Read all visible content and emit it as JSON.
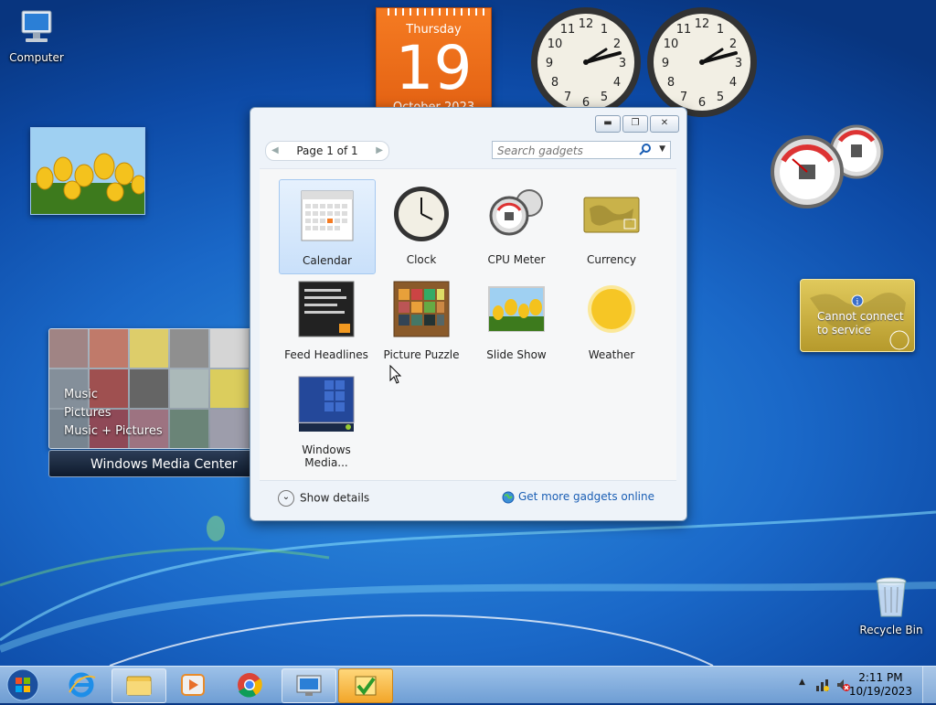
{
  "desktop": {
    "icons": [
      {
        "label": "Computer"
      },
      {
        "label": "Recycle Bin"
      }
    ]
  },
  "calendar_gadget": {
    "weekday": "Thursday",
    "day": "19",
    "month_year": "October 2023"
  },
  "media_center": {
    "menu": [
      "Music",
      "Pictures",
      "Music + Pictures"
    ],
    "title": "Windows Media Center"
  },
  "currency_gadget": {
    "message_line1": "Cannot connect",
    "message_line2": "to service"
  },
  "cpu_gadget": {
    "cpu_percent": "24%",
    "memory_percent": "29%"
  },
  "gallery": {
    "pager": "Page 1 of 1",
    "search_placeholder": "Search gadgets",
    "tiles": [
      {
        "label": "Calendar"
      },
      {
        "label": "Clock"
      },
      {
        "label": "CPU Meter"
      },
      {
        "label": "Currency"
      },
      {
        "label": "Feed Headlines"
      },
      {
        "label": "Picture Puzzle"
      },
      {
        "label": "Slide Show"
      },
      {
        "label": "Weather"
      },
      {
        "label": "Windows Media..."
      }
    ],
    "show_details": "Show details",
    "get_more": "Get more gadgets online"
  },
  "taskbar": {
    "time": "2:11 PM",
    "date": "10/19/2023"
  },
  "colors": {
    "accent": "#1a5eb4",
    "calendar_orange": "#f57b22"
  }
}
